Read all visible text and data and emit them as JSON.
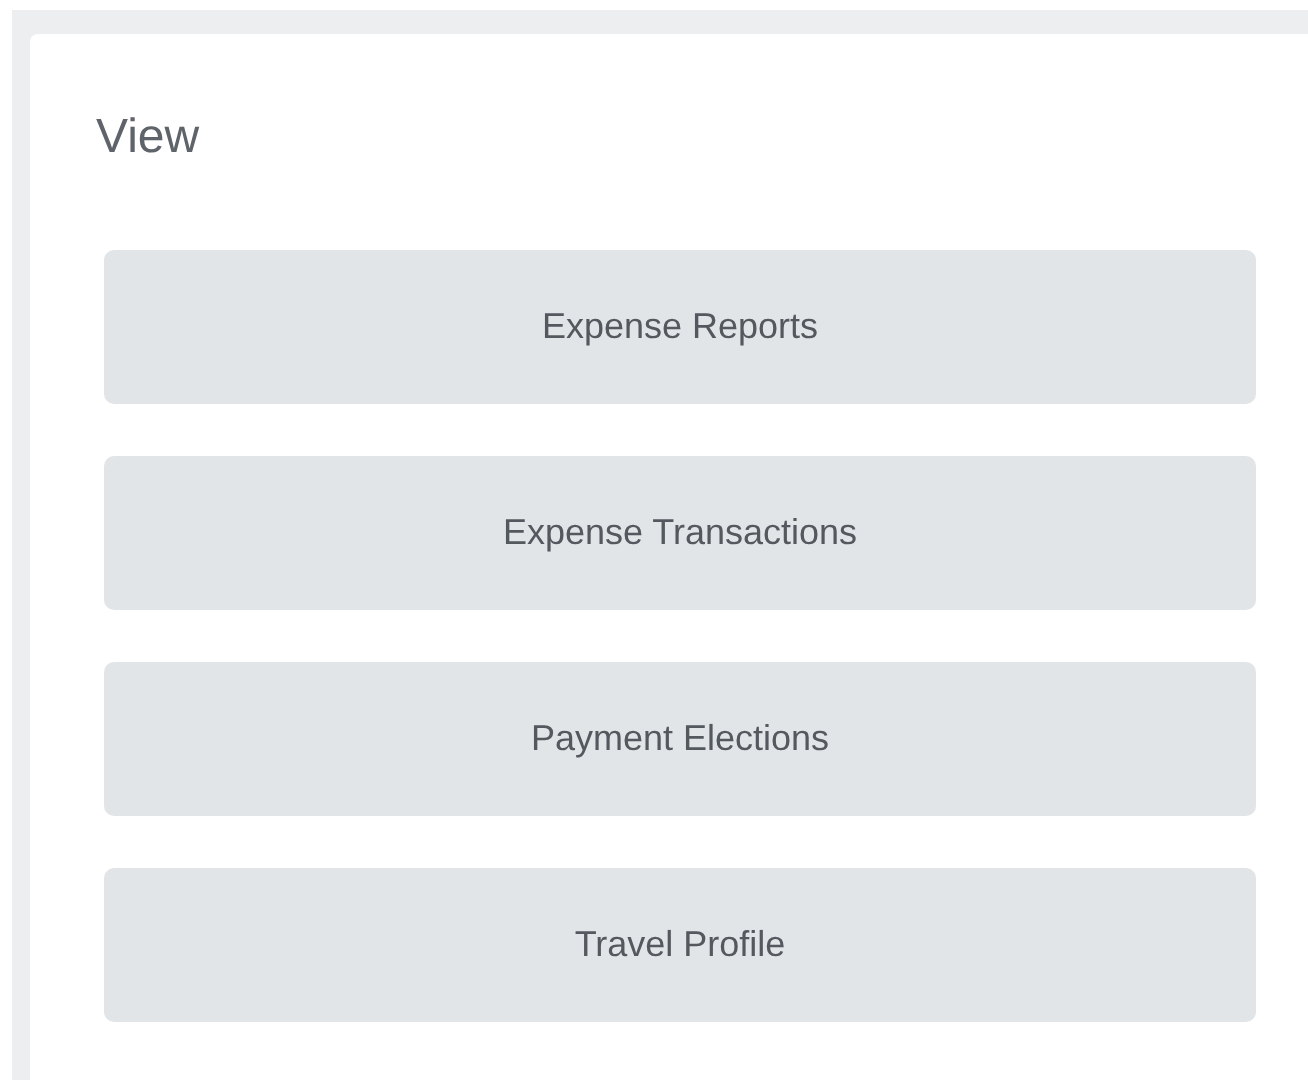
{
  "section": {
    "title": "View"
  },
  "buttons": [
    {
      "label": "Expense Reports"
    },
    {
      "label": "Expense Transactions"
    },
    {
      "label": "Payment Elections"
    },
    {
      "label": "Travel Profile"
    }
  ]
}
